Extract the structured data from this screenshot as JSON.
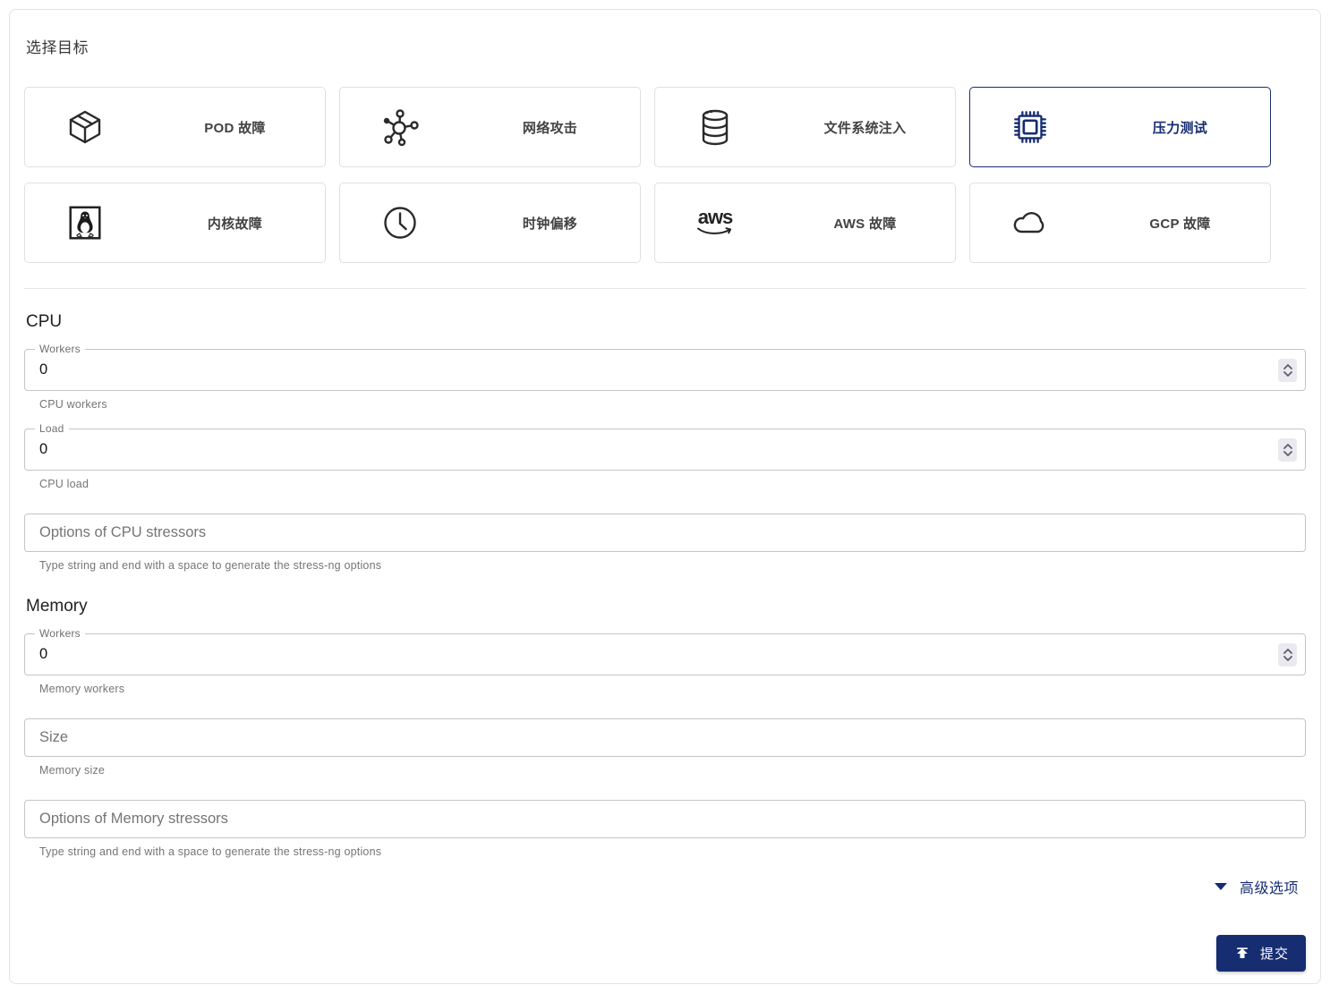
{
  "page": {
    "select_target_title": "选择目标"
  },
  "colors": {
    "primary": "#172d72",
    "card_border": "#e0e0e0",
    "input_border": "#c4c4c4",
    "text_secondary": "#757575"
  },
  "targets": {
    "aws_logo_text": "aws",
    "cards": [
      {
        "label": "POD 故障",
        "icon": "pod-cube-icon",
        "selected": false
      },
      {
        "label": "网络攻击",
        "icon": "network-attack-icon",
        "selected": false
      },
      {
        "label": "文件系统注入",
        "icon": "filesystem-database-icon",
        "selected": false
      },
      {
        "label": "压力测试",
        "icon": "cpu-chip-icon",
        "selected": true
      },
      {
        "label": "内核故障",
        "icon": "linux-tux-icon",
        "selected": false
      },
      {
        "label": "时钟偏移",
        "icon": "clock-icon",
        "selected": false
      },
      {
        "label": "AWS 故障",
        "icon": "aws-logo-icon",
        "selected": false
      },
      {
        "label": "GCP 故障",
        "icon": "cloud-icon",
        "selected": false
      }
    ]
  },
  "cpu": {
    "heading": "CPU",
    "workers": {
      "label": "Workers",
      "value": "0",
      "helper": "CPU workers"
    },
    "load": {
      "label": "Load",
      "value": "0",
      "helper": "CPU load"
    },
    "options": {
      "placeholder": "Options of CPU stressors",
      "helper": "Type string and end with a space to generate the stress-ng options"
    }
  },
  "memory": {
    "heading": "Memory",
    "workers": {
      "label": "Workers",
      "value": "0",
      "helper": "Memory workers"
    },
    "size": {
      "placeholder": "Size",
      "helper": "Memory size"
    },
    "options": {
      "placeholder": "Options of Memory stressors",
      "helper": "Type string and end with a space to generate the stress-ng options"
    }
  },
  "footer": {
    "advanced_options": "高级选项",
    "submit": "提交"
  }
}
